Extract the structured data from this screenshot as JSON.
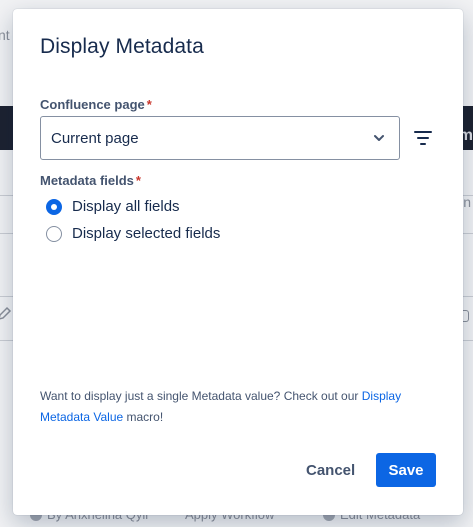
{
  "background": {
    "top_text": "nt",
    "band_char": "m",
    "right_char": "n",
    "footer": {
      "item1": "By Anxhelina Qyli",
      "item2": "Apply Workflow",
      "item3": "Edit Metadata"
    }
  },
  "dialog": {
    "title": "Display Metadata",
    "confluence_page": {
      "label": "Confluence page",
      "required_mark": "*",
      "selected_value": "Current page"
    },
    "metadata_fields": {
      "label": "Metadata fields",
      "required_mark": "*",
      "options": [
        {
          "label": "Display all fields",
          "selected": true
        },
        {
          "label": "Display selected fields",
          "selected": false
        }
      ]
    },
    "info": {
      "text_before": "Want to display just a single Metadata value? Check out our ",
      "link_text": "Display Metadata Value",
      "text_after": " macro!"
    },
    "buttons": {
      "cancel": "Cancel",
      "save": "Save"
    }
  },
  "colors": {
    "primary": "#0c66e4",
    "required": "#c9372c",
    "text": "#172b4d",
    "subtle_text": "#44546f"
  }
}
